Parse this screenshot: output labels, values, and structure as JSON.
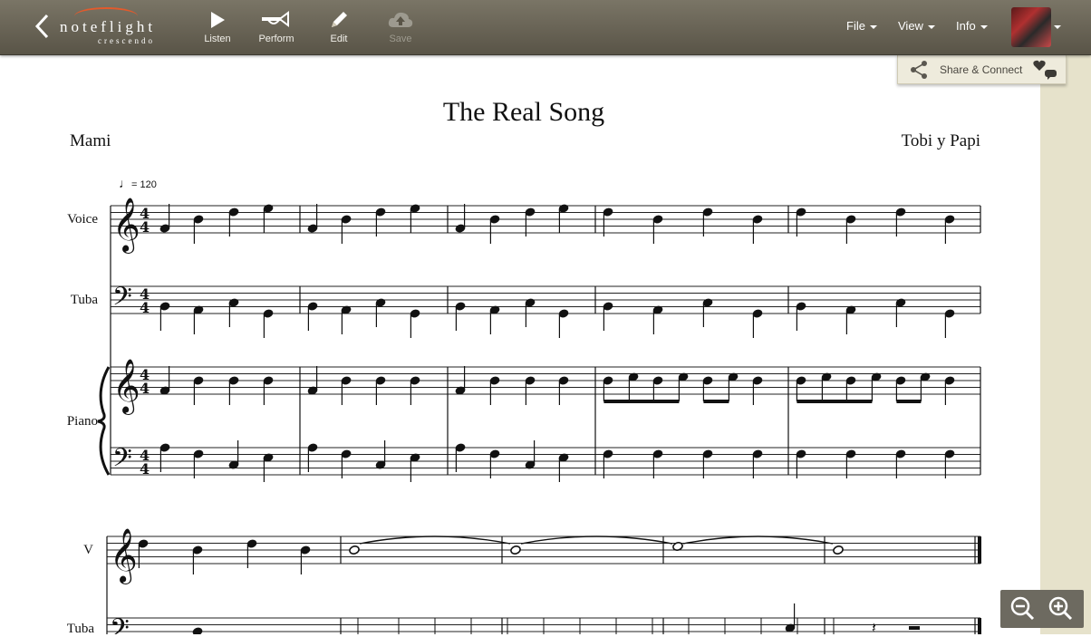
{
  "toolbar": {
    "logo": {
      "word": "noteflight",
      "sub": "crescendo"
    },
    "buttons": [
      {
        "label": "Listen",
        "icon": "play-icon"
      },
      {
        "label": "Perform",
        "icon": "trumpet-icon"
      },
      {
        "label": "Edit",
        "icon": "pencil-icon"
      },
      {
        "label": "Save",
        "icon": "cloud-upload-icon",
        "disabled": true
      }
    ],
    "menus": [
      "File",
      "View",
      "Info"
    ]
  },
  "share": {
    "label": "Share & Connect"
  },
  "score": {
    "title": "The Real Song",
    "subtitle": "Mami",
    "composer": "Tobi y Papi",
    "tempo": "= 120",
    "instruments": {
      "voice": "Voice",
      "tuba": "Tuba",
      "piano": "Piano",
      "voice_short": "V",
      "tuba_short": "Tuba"
    },
    "time_signature": "4/4"
  },
  "colors": {
    "toolbar": "#6b6658",
    "strip": "#e6e2cb",
    "logo_accent": "#e45a2b"
  }
}
